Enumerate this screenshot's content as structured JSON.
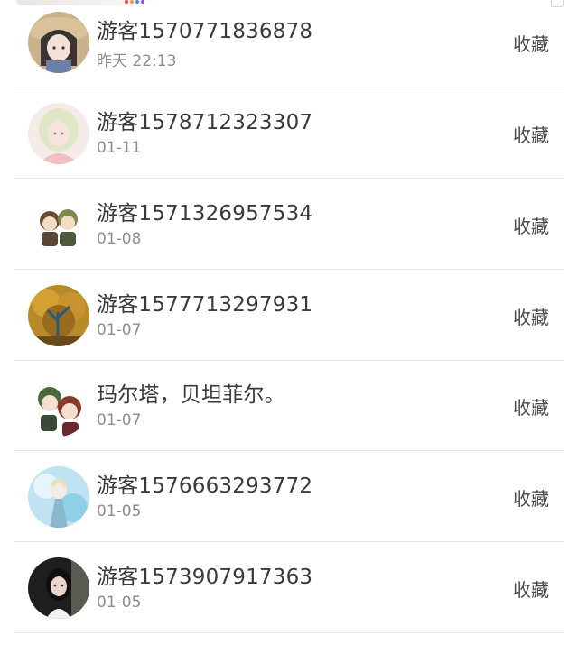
{
  "favorite_label": "收藏",
  "contacts": [
    {
      "name": "游客1570771836878",
      "time": "昨天 22:13",
      "avatar_icon": "anime-girl-straw-hat-avatar"
    },
    {
      "name": "游客1578712323307",
      "time": "01-11",
      "avatar_icon": "anime-girl-pastel-avatar"
    },
    {
      "name": "游客1571326957534",
      "time": "01-08",
      "avatar_icon": "chibi-duo-avatar"
    },
    {
      "name": "游客1577713297931",
      "time": "01-07",
      "avatar_icon": "autumn-tree-avatar"
    },
    {
      "name": "玛尔塔，贝坦菲尔。",
      "time": "01-07",
      "avatar_icon": "chibi-pair-avatar"
    },
    {
      "name": "游客1576663293772",
      "time": "01-05",
      "avatar_icon": "ice-princess-avatar"
    },
    {
      "name": "游客1573907917363",
      "time": "01-05",
      "avatar_icon": "girl-photo-avatar"
    }
  ],
  "colors": {
    "name_text": "#3a3a3a",
    "time_text": "#8e8e8e",
    "divider": "#e4e4e4"
  }
}
